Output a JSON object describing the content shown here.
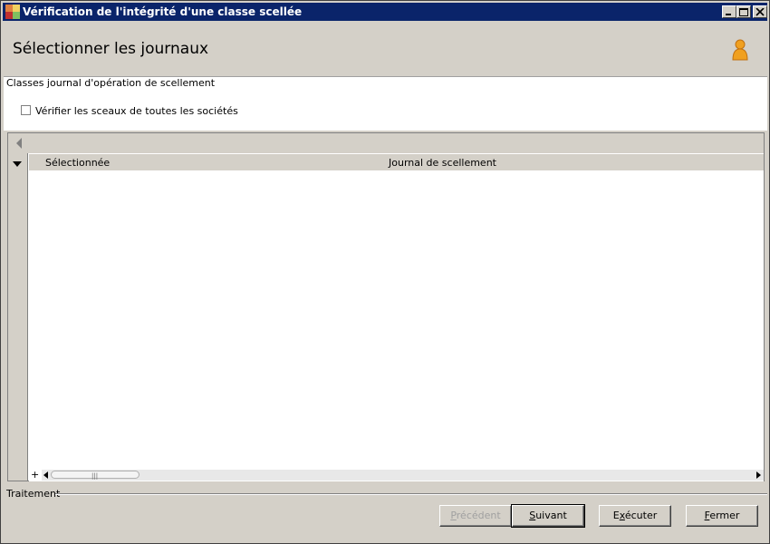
{
  "window": {
    "title": "Vérification de l'intégrité d'une classe scellée"
  },
  "header": {
    "title": "Sélectionner les journaux",
    "icon": "user-icon"
  },
  "group": {
    "label": "Classes journal d'opération de scellement"
  },
  "options": {
    "verify_all_label": "Vérifier les sceaux de toutes les sociétés",
    "verify_all_checked": false
  },
  "grid": {
    "columns": [
      "Sélectionnée",
      "Journal de scellement"
    ],
    "rows": [],
    "add_label": "+"
  },
  "footer": {
    "section_label": "Traitement"
  },
  "buttons": {
    "prev": {
      "label": "Précédent",
      "mnemonic": "P",
      "rest": "récédent",
      "enabled": false
    },
    "next": {
      "label": "Suivant",
      "mnemonic": "S",
      "rest": "uivant"
    },
    "exec": {
      "label": "Exécuter",
      "mnemonic": "x",
      "pre": "E",
      "rest": "écuter"
    },
    "close": {
      "label": "Fermer",
      "mnemonic": "F",
      "rest": "ermer"
    }
  },
  "colors": {
    "titlebar": "#0a246a",
    "face": "#d4d0c8"
  }
}
